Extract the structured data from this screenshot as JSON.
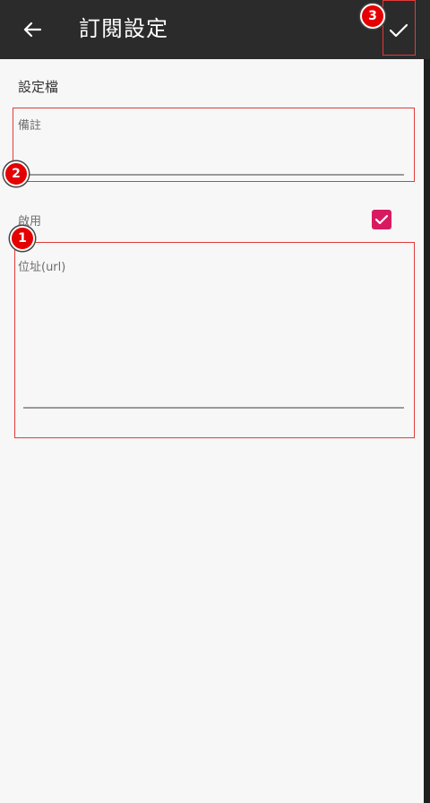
{
  "app_bar": {
    "title": "訂閱設定",
    "back_icon": "arrow-left-icon",
    "confirm_icon": "check-icon"
  },
  "form": {
    "section_title": "設定檔",
    "note": {
      "label": "備註",
      "value": ""
    },
    "enabled": {
      "label": "啟用",
      "checked": true
    },
    "url": {
      "label": "位址(url)",
      "value": ""
    }
  },
  "annotations": {
    "markers": [
      "1",
      "2",
      "3"
    ]
  },
  "colors": {
    "app_bar": "#2b2b2b",
    "background": "#f7f7f7",
    "checkbox": "#d81b60",
    "highlight": "#e23b3b",
    "marker": "#e40000"
  }
}
